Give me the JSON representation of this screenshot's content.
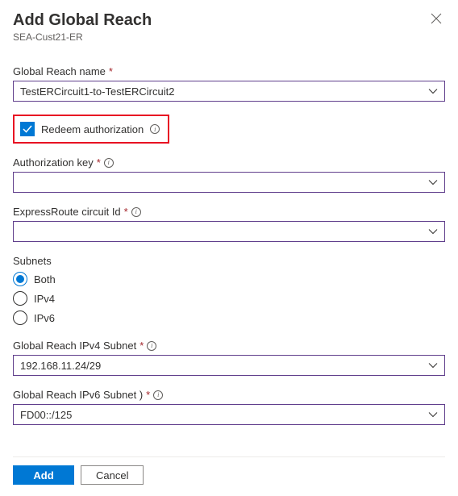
{
  "header": {
    "title": "Add Global Reach",
    "subtitle": "SEA-Cust21-ER"
  },
  "fields": {
    "globalReachName": {
      "label": "Global Reach name",
      "value": "TestERCircuit1-to-TestERCircuit2"
    },
    "redeemAuth": {
      "label": "Redeem authorization",
      "checked": true
    },
    "authKey": {
      "label": "Authorization key",
      "value": ""
    },
    "circuitId": {
      "label": "ExpressRoute circuit Id",
      "value": ""
    },
    "subnets": {
      "label": "Subnets",
      "options": {
        "both": "Both",
        "ipv4": "IPv4",
        "ipv6": "IPv6"
      },
      "selected": "both"
    },
    "ipv4Subnet": {
      "label": "Global Reach IPv4 Subnet",
      "value": "192.168.11.24/29"
    },
    "ipv6Subnet": {
      "label": "Global Reach IPv6 Subnet )",
      "value": "FD00::/125"
    }
  },
  "footer": {
    "add": "Add",
    "cancel": "Cancel"
  }
}
